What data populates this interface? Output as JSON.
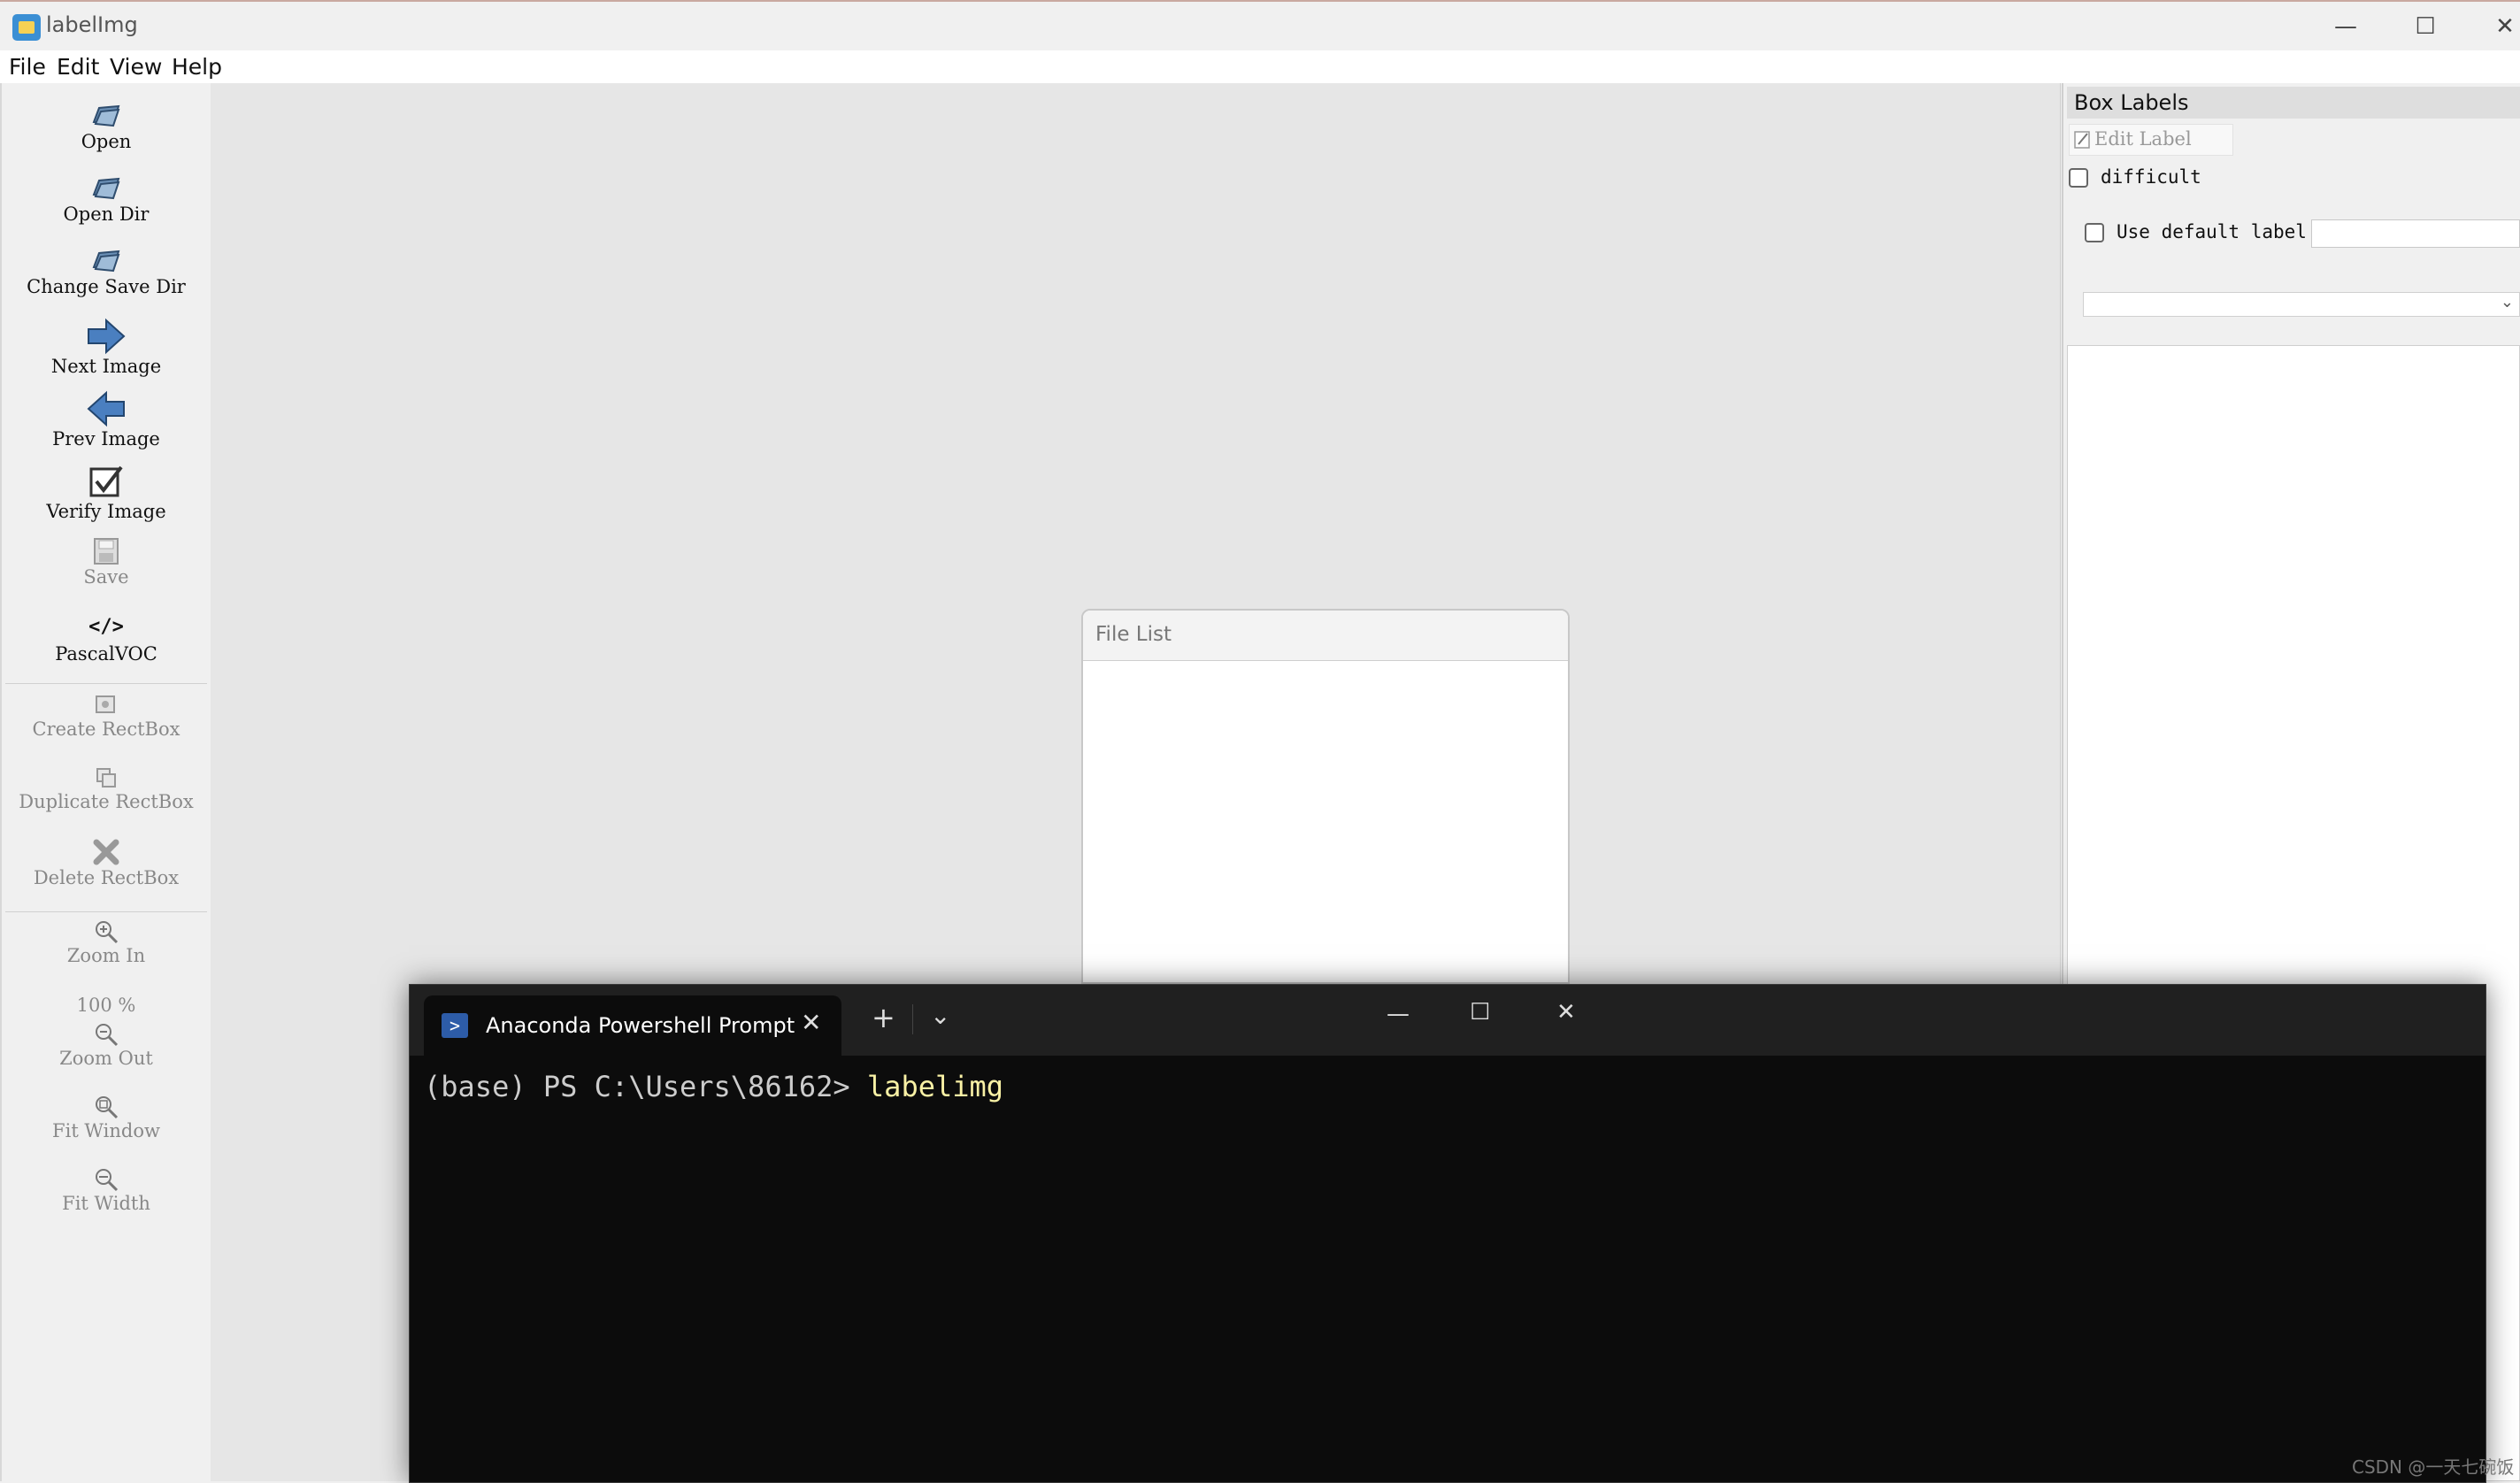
{
  "window": {
    "title": "labelImg"
  },
  "menubar": [
    "File",
    "Edit",
    "View",
    "Help"
  ],
  "toolbar": {
    "open": "Open",
    "open_dir": "Open Dir",
    "change_save_dir": "Change Save Dir",
    "next_image": "Next Image",
    "prev_image": "Prev Image",
    "verify_image": "Verify Image",
    "save": "Save",
    "format_icon": "</>",
    "format": "PascalVOC",
    "create_rectbox": "Create RectBox",
    "duplicate_rectbox": "Duplicate RectBox",
    "delete_rectbox": "Delete RectBox",
    "zoom_in": "Zoom In",
    "zoom_level": "100 %",
    "zoom_out": "Zoom Out",
    "fit_window": "Fit Window",
    "fit_width": "Fit Width"
  },
  "box_labels": {
    "title": "Box Labels",
    "edit_label": "Edit Label",
    "difficult": "difficult",
    "use_default_label": "Use default label",
    "default_label_value": ""
  },
  "file_list": {
    "title": "File List"
  },
  "terminal": {
    "tab_title": "Anaconda Powershell Prompt",
    "prompt": "(base) PS C:\\Users\\86162> ",
    "command": "labelimg"
  },
  "watermark": "CSDN @一天七碗饭"
}
